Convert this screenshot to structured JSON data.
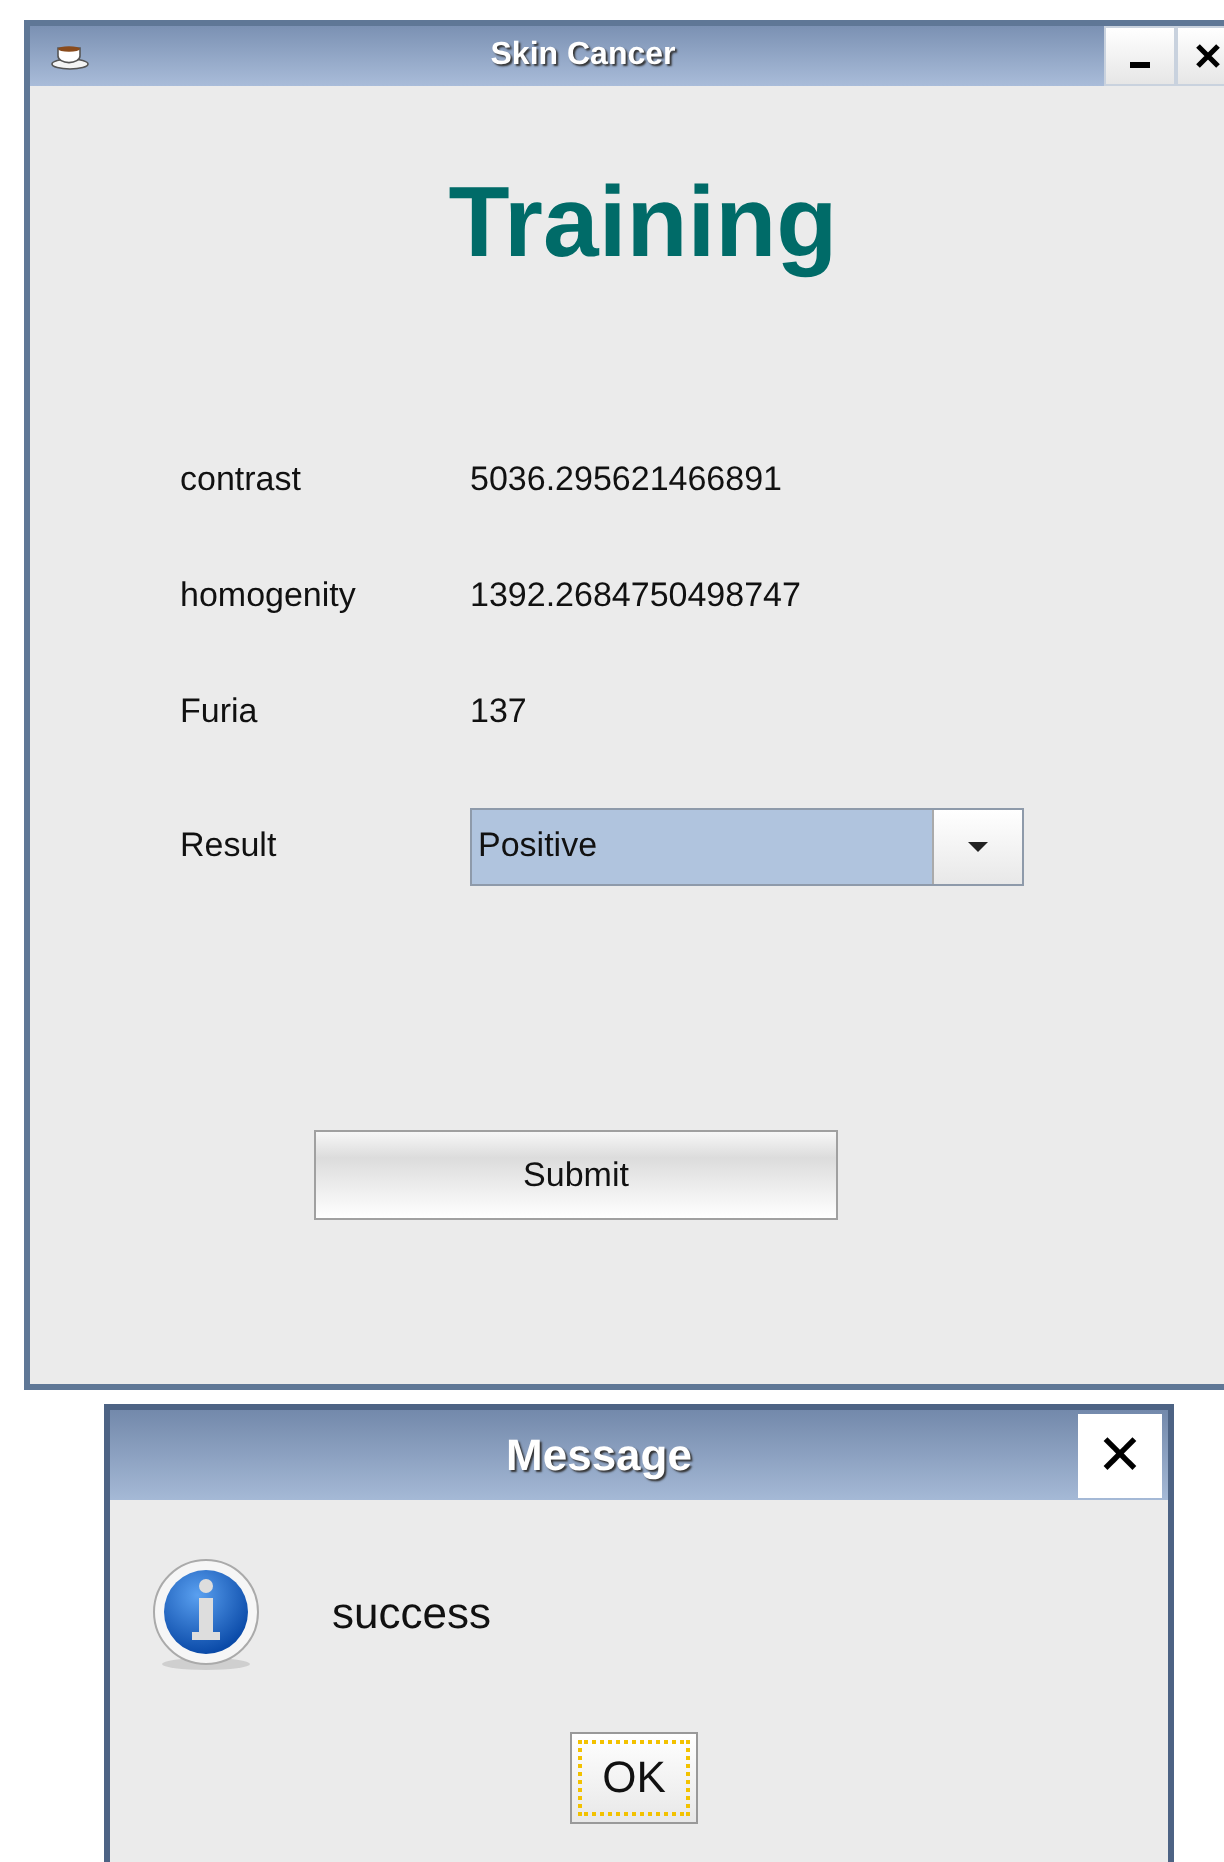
{
  "window": {
    "title": "Skin Cancer",
    "heading": "Training"
  },
  "fields": [
    {
      "kind": "reading",
      "label": "contrast",
      "value": "5036.295621466891"
    },
    {
      "kind": "reading",
      "label": "homogenity",
      "value": "1392.2684750498747"
    },
    {
      "kind": "reading",
      "label": "Furia",
      "value": "137"
    },
    {
      "kind": "combo",
      "label": "Result",
      "value": "Positive"
    }
  ],
  "submit_button": "Submit",
  "dialog": {
    "title": "Message",
    "close": "✕",
    "message": "success",
    "ok_button": "OK",
    "ok_focused": true
  }
}
